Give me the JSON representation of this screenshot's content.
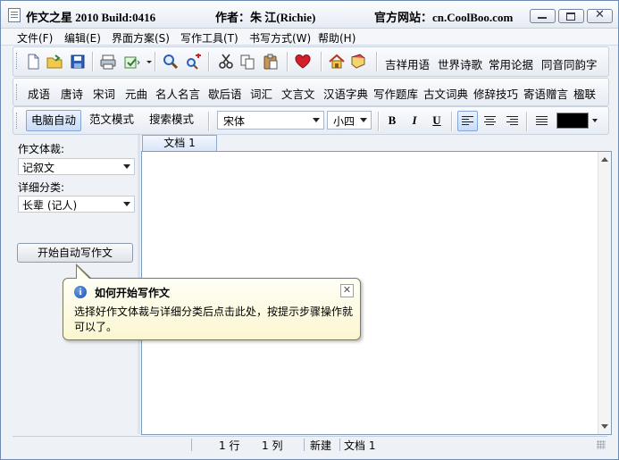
{
  "titlebar": {
    "app": "作文之星 2010 Build:0416",
    "author": "作者：朱 江(Richie)",
    "site": "官方网站：cn.CoolBoo.com",
    "min_label": "minimize",
    "max_label": "maximize",
    "close_glyph": "✕"
  },
  "menu": [
    "文件(F)",
    "编辑(E)",
    "界面方案(S)",
    "写作工具(T)",
    "书写方式(W)",
    "帮助(H)"
  ],
  "toolbar1": {
    "icons": [
      "new-doc-icon",
      "open-folder-icon",
      "save-icon",
      "print-icon",
      "export-icon",
      "find-icon",
      "replace-icon",
      "copy-icon",
      "paste-icon",
      "clipboard-icon",
      "favorite-heart-icon",
      "home-icon",
      "book-icon"
    ],
    "links": [
      "吉祥用语",
      "世界诗歌",
      "常用论据",
      "同音同韵字"
    ]
  },
  "toolbar2": {
    "links": [
      "成语",
      "唐诗",
      "宋词",
      "元曲",
      "名人名言",
      "歇后语",
      "词汇",
      "文言文",
      "汉语字典",
      "写作题库",
      "古文词典",
      "修辞技巧",
      "寄语赠言",
      "楹联"
    ]
  },
  "toolbar3": {
    "modes": [
      "电脑自动",
      "范文模式",
      "搜索模式"
    ],
    "font": "宋体",
    "size": "小四",
    "bold": "B",
    "italic": "I",
    "underline": "U",
    "color": "#000000"
  },
  "left_panel": {
    "genre_label": "作文体裁:",
    "genre_value": "记叙文",
    "category_label": "详细分类:",
    "category_value": "长辈 (记人)",
    "start_button": "开始自动写作文"
  },
  "editor": {
    "tab": "文档 1",
    "content": ""
  },
  "tooltip": {
    "title": "如何开始写作文",
    "body": "选择好作文体裁与详细分类后点击此处，按提示步骤操作就可以了。",
    "icon_glyph": "i",
    "close_glyph": "✕"
  },
  "status": {
    "row": "1 行",
    "col": "1 列",
    "state": "新建",
    "doc": "文档 1"
  },
  "colors": {
    "accent": "#86a6d6",
    "tooltip_bg": "#fffff4",
    "border": "#7f9db9"
  }
}
